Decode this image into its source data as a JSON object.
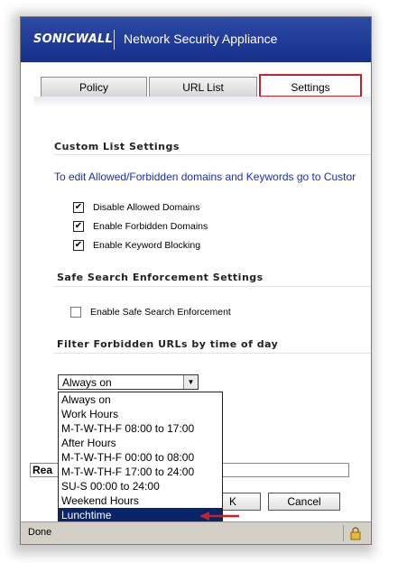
{
  "header": {
    "logo_text": "SONICWALL",
    "title": "Network Security Appliance"
  },
  "tabs": [
    {
      "label": "Policy"
    },
    {
      "label": "URL List"
    },
    {
      "label": "Settings"
    }
  ],
  "custom_list": {
    "heading": "Custom List Settings",
    "note": "To edit Allowed/Forbidden domains and Keywords go to Custor",
    "options": [
      {
        "label": "Disable Allowed Domains",
        "checked": true
      },
      {
        "label": "Enable Forbidden Domains",
        "checked": true
      },
      {
        "label": "Enable Keyword Blocking",
        "checked": true
      }
    ]
  },
  "safe_search": {
    "heading": "Safe Search Enforcement Settings",
    "option_label": "Enable Safe Search Enforcement",
    "checked": false
  },
  "time_filter": {
    "heading": "Filter Forbidden URLs by time of day",
    "selected": "Always on",
    "options": [
      "Always on",
      "Work Hours",
      "M-T-W-TH-F 08:00 to 17:00",
      "After Hours",
      "M-T-W-TH-F 00:00 to 08:00",
      "M-T-W-TH-F 17:00 to 24:00",
      "SU-S 00:00 to 24:00",
      "Weekend Hours",
      "Lunchtime"
    ],
    "highlighted_index": 8
  },
  "footer": {
    "ready_text": "Rea",
    "ok_label": "K",
    "cancel_label": "Cancel"
  },
  "statusbar": {
    "text": "Done"
  },
  "colors": {
    "banner": "#1e3a9a",
    "tab_highlight": "#c0232b",
    "link": "#1b2fb5",
    "selection": "#0a246a",
    "arrow": "#c0232b"
  }
}
